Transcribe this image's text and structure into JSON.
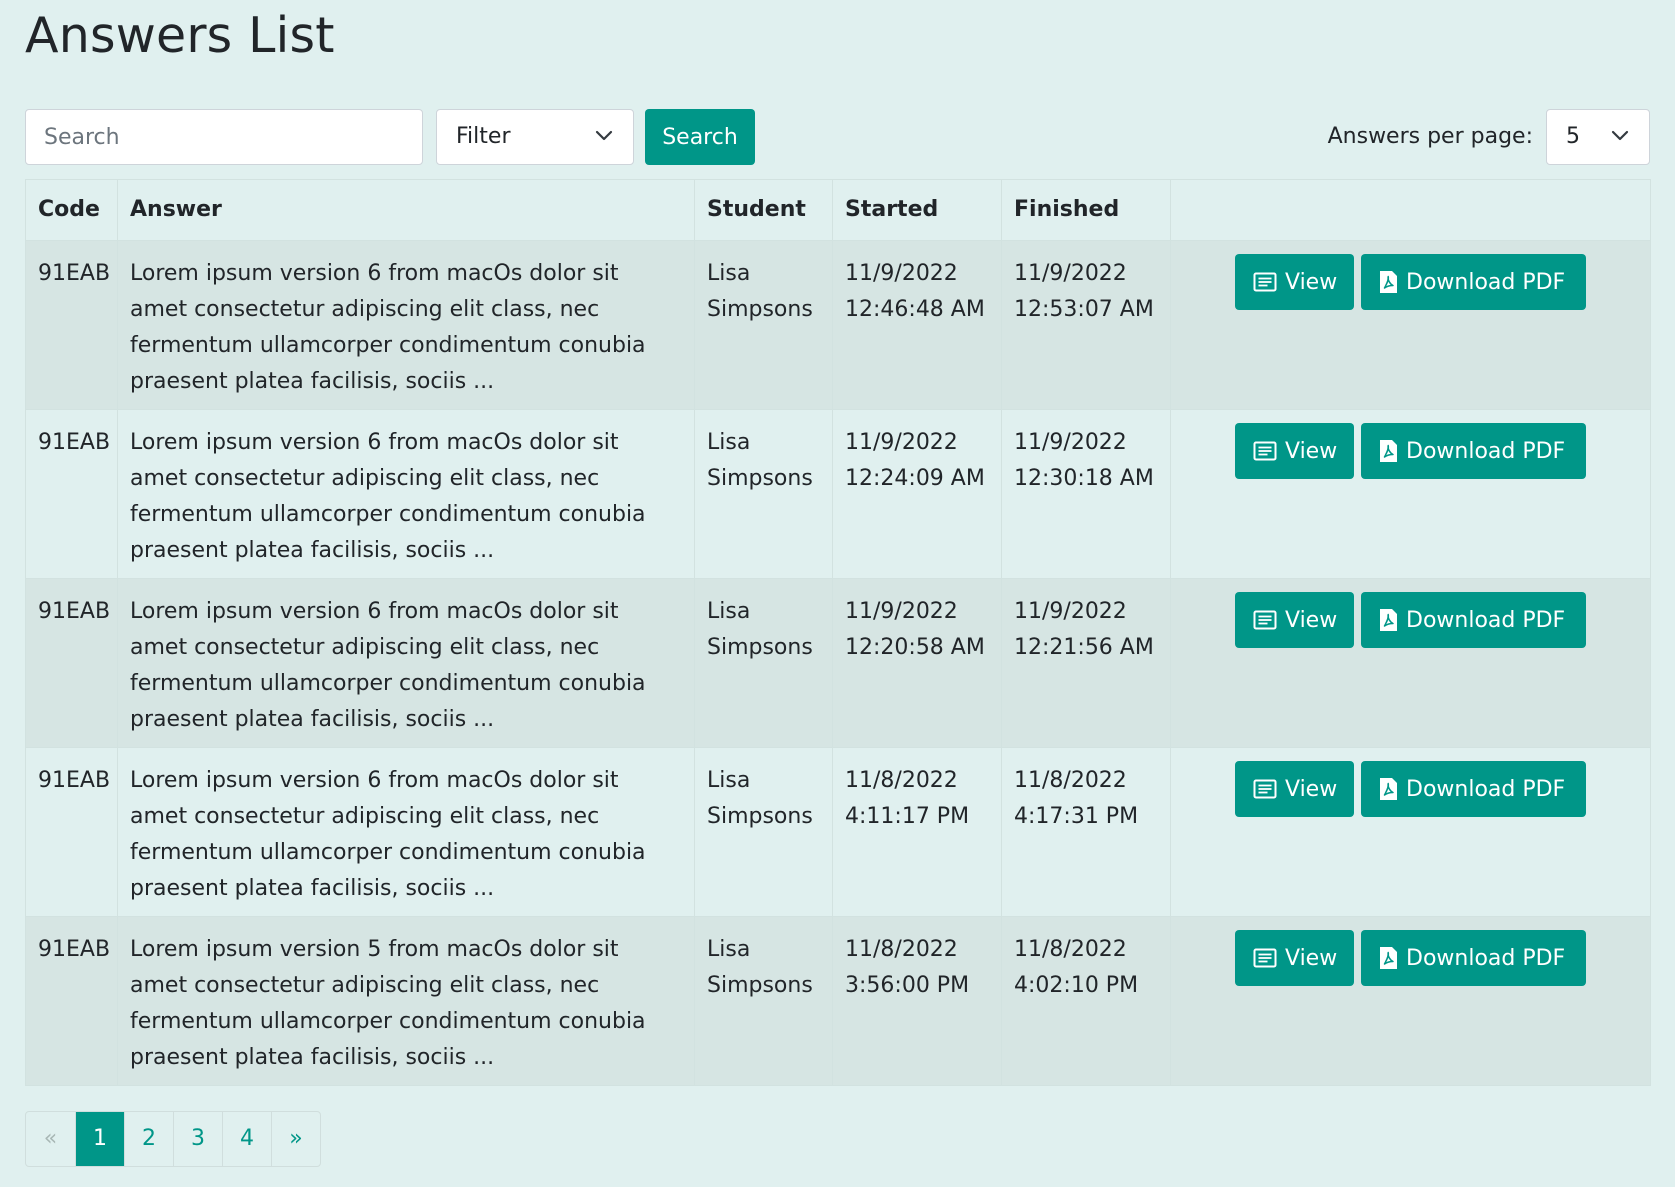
{
  "page_title": "Answers List",
  "toolbar": {
    "search_placeholder": "Search",
    "filter_value": "Filter",
    "search_button": "Search",
    "per_page_label": "Answers per page:",
    "per_page_value": "5"
  },
  "table": {
    "headers": [
      "Code",
      "Answer",
      "Student",
      "Started",
      "Finished",
      ""
    ],
    "rows": [
      {
        "code": "91EAB",
        "answer": "Lorem ipsum version 6 from macOs dolor sit amet consectetur adipiscing elit class, nec fermentum ullamcorper condimentum conubia praesent platea facilisis, sociis ...",
        "student": "Lisa Simpsons",
        "started": "11/9/2022 12:46:48 AM",
        "finished": "11/9/2022 12:53:07 AM"
      },
      {
        "code": "91EAB",
        "answer": "Lorem ipsum version 6 from macOs dolor sit amet consectetur adipiscing elit class, nec fermentum ullamcorper condimentum conubia praesent platea facilisis, sociis ...",
        "student": "Lisa Simpsons",
        "started": "11/9/2022 12:24:09 AM",
        "finished": "11/9/2022 12:30:18 AM"
      },
      {
        "code": "91EAB",
        "answer": "Lorem ipsum version 6 from macOs dolor sit amet consectetur adipiscing elit class, nec fermentum ullamcorper condimentum conubia praesent platea facilisis, sociis ...",
        "student": "Lisa Simpsons",
        "started": "11/9/2022 12:20:58 AM",
        "finished": "11/9/2022 12:21:56 AM"
      },
      {
        "code": "91EAB",
        "answer": "Lorem ipsum version 6 from macOs dolor sit amet consectetur adipiscing elit class, nec fermentum ullamcorper condimentum conubia praesent platea facilisis, sociis ...",
        "student": "Lisa Simpsons",
        "started": "11/8/2022 4:11:17 PM",
        "finished": "11/8/2022 4:17:31 PM"
      },
      {
        "code": "91EAB",
        "answer": "Lorem ipsum version 5 from macOs dolor sit amet consectetur adipiscing elit class, nec fermentum ullamcorper condimentum conubia praesent platea facilisis, sociis ...",
        "student": "Lisa Simpsons",
        "started": "11/8/2022 3:56:00 PM",
        "finished": "11/8/2022 4:02:10 PM"
      }
    ],
    "actions": {
      "view_label": "View",
      "download_label": "Download PDF",
      "view_icon": "list-icon",
      "download_icon": "pdf-file-icon"
    }
  },
  "pagination": {
    "prev": "«",
    "pages": [
      "1",
      "2",
      "3",
      "4"
    ],
    "active_page": "1",
    "next": "»"
  },
  "colors": {
    "accent": "#009688",
    "background": "#e0f0ef",
    "striped_row": "#d6e5e3"
  }
}
